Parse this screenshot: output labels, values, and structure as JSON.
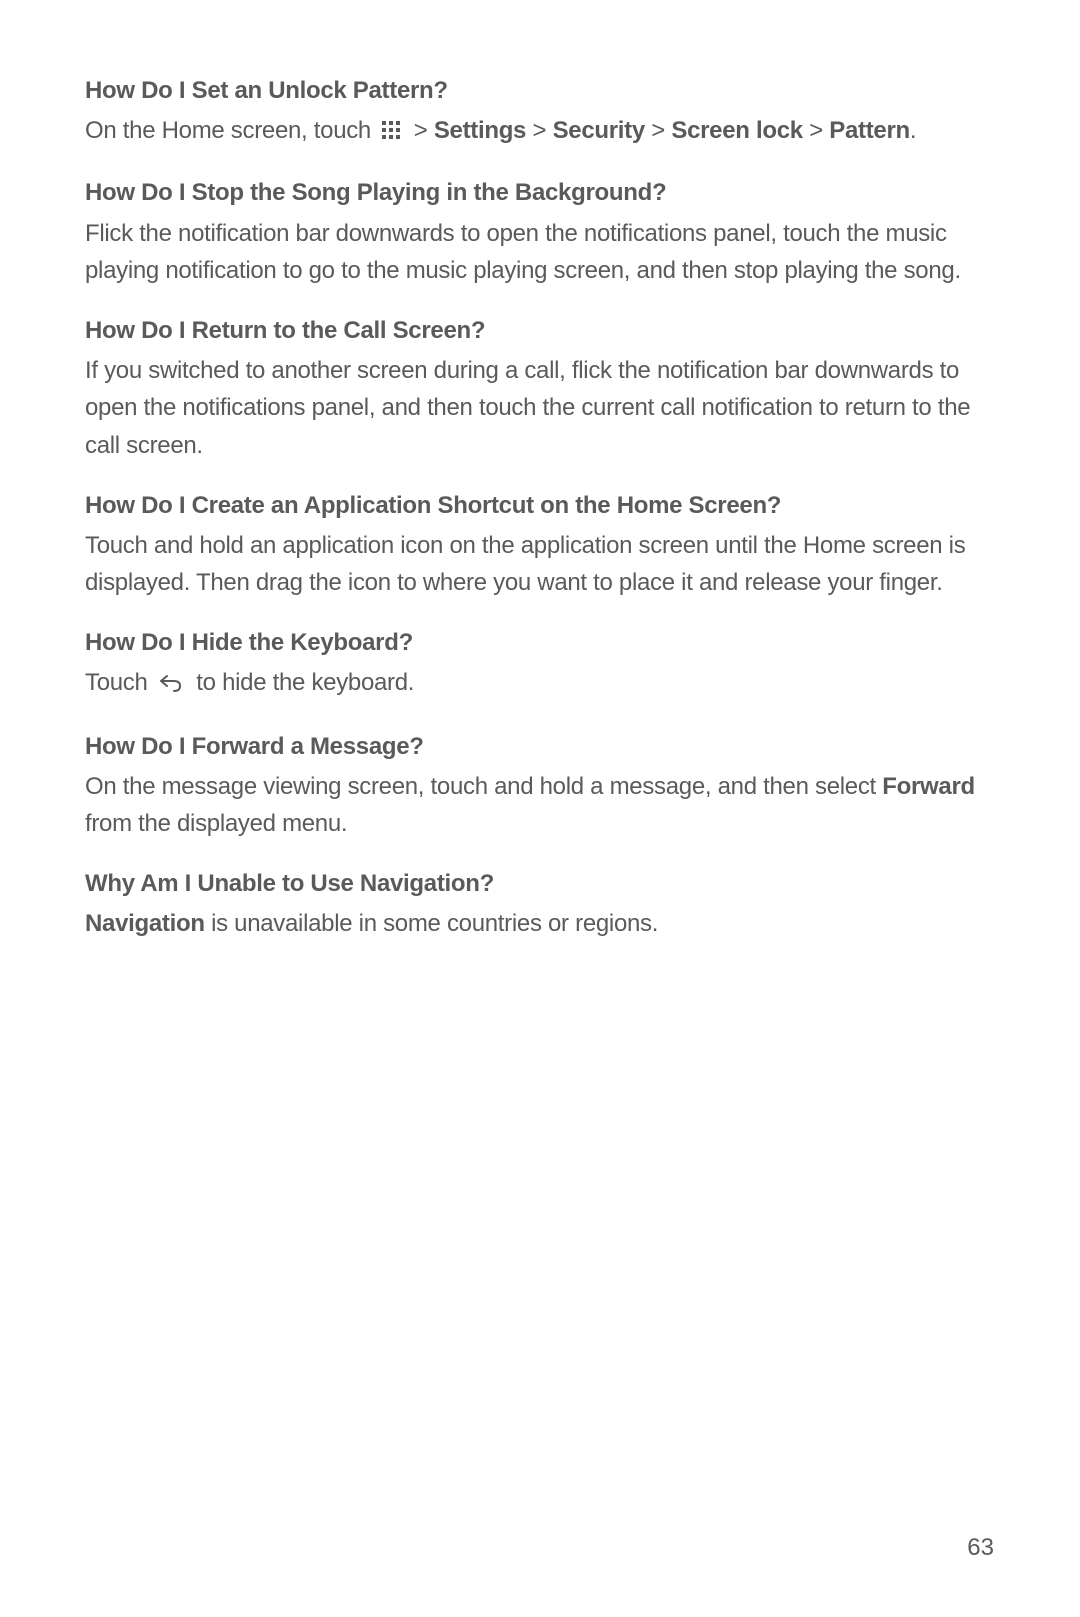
{
  "page_number": "63",
  "s1": {
    "heading": "How Do I Set an Unlock Pattern?",
    "p_pre": "On the Home screen, touch ",
    "p_mid": " > ",
    "settings": "Settings",
    "sep1": " > ",
    "security": "Security",
    "sep2": " > ",
    "screenlock": "Screen lock",
    "sep3": " > ",
    "pattern": "Pattern",
    "period": "."
  },
  "s2": {
    "heading": "How Do I Stop the Song Playing in the Background?",
    "p": "Flick the notification bar downwards to open the notifications panel, touch the music playing notification to go to the music playing screen, and then stop playing the song."
  },
  "s3": {
    "heading": "How Do I Return to the Call Screen?",
    "p": "If you switched to another screen during a call, flick the notification bar downwards to open the notifications panel, and then touch the current call notification to return to the call screen."
  },
  "s4": {
    "heading": "How Do I Create an Application Shortcut on the Home Screen?",
    "p": "Touch and hold an application icon on the application screen until the Home screen is displayed. Then drag the icon to where you want to place it and release your finger."
  },
  "s5": {
    "heading": "How Do I Hide the Keyboard?",
    "p_pre": "Touch ",
    "p_post": " to hide the keyboard."
  },
  "s6": {
    "heading": "How Do I Forward a Message?",
    "p_pre": "On the message viewing screen, touch and hold a message, and then select ",
    "forward": "Forward",
    "p_post": " from the displayed menu."
  },
  "s7": {
    "heading": "Why Am I Unable to Use Navigation?",
    "navigation": "Navigation",
    "p_post": " is unavailable in some countries or regions."
  }
}
